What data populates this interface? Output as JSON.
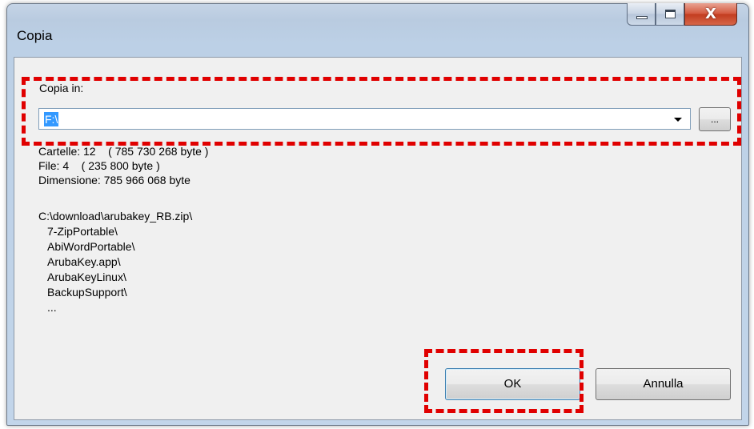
{
  "window": {
    "title": "Copia",
    "close_glyph": "X"
  },
  "copy": {
    "label": "Copia in:",
    "destination_value": "F:\\",
    "browse_label": "..."
  },
  "summary": {
    "folders": "Cartelle: 12    ( 785 730 268 byte )",
    "files": "File: 4    ( 235 800 byte )",
    "size": "Dimensione: 785 966 068 byte"
  },
  "listing": {
    "source": "C:\\download\\arubakey_RB.zip\\",
    "items": [
      "7-ZipPortable\\",
      "AbiWordPortable\\",
      "ArubaKey.app\\",
      "ArubaKeyLinux\\",
      "BackupSupport\\"
    ],
    "more": "..."
  },
  "buttons": {
    "ok": "OK",
    "cancel": "Annulla"
  },
  "colors": {
    "highlight_dash": "#e00000",
    "selection": "#3399ff"
  }
}
